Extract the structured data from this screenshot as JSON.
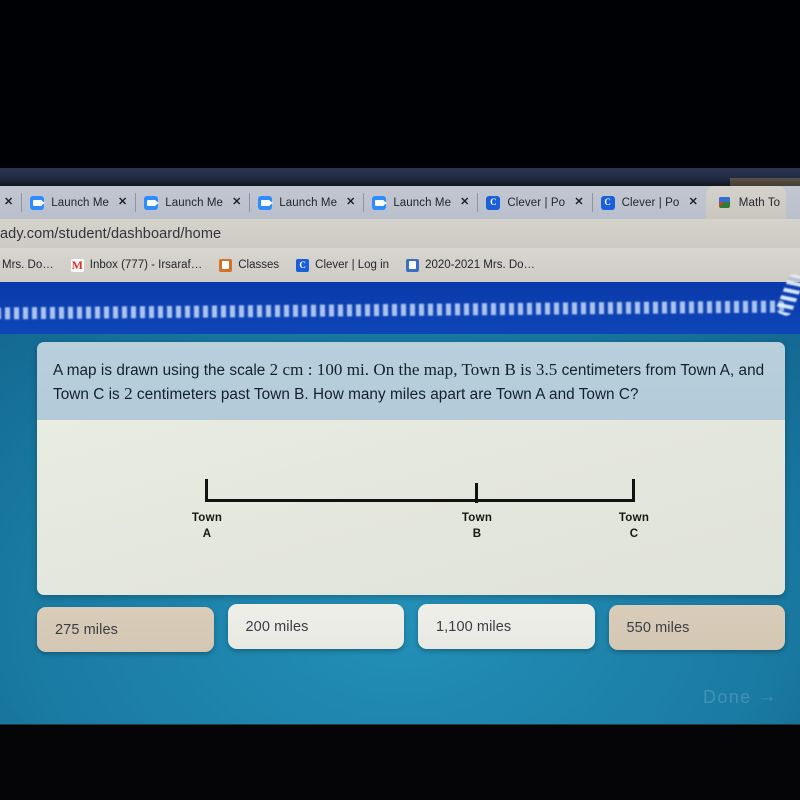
{
  "browser": {
    "tabs": [
      {
        "title": "",
        "favicon": "zoom-icon",
        "active": false,
        "partial": true
      },
      {
        "title": "Launch Me",
        "favicon": "zoom-icon",
        "active": false
      },
      {
        "title": "Launch Me",
        "favicon": "zoom-icon",
        "active": false
      },
      {
        "title": "Launch Me",
        "favicon": "zoom-icon",
        "active": false
      },
      {
        "title": "Launch Me",
        "favicon": "zoom-icon",
        "active": false
      },
      {
        "title": "Clever | Por",
        "favicon": "clever-icon",
        "active": false
      },
      {
        "title": "Clever | Por",
        "favicon": "clever-icon",
        "active": false
      },
      {
        "title": "Math To",
        "favicon": "cube-icon",
        "active": true
      }
    ],
    "tab_close_label": "✕",
    "address": "ady.com/student/dashboard/home",
    "bookmarks": [
      {
        "label": "Mrs. Do…",
        "icon": "none"
      },
      {
        "label": "Inbox (777) - Irsaraf…",
        "icon": "gmail-icon",
        "icon_glyph": "M"
      },
      {
        "label": "Classes",
        "icon": "classroom-icon"
      },
      {
        "label": "Clever | Log in",
        "icon": "clever-icon",
        "icon_glyph": "C"
      },
      {
        "label": "2020-2021 Mrs. Do…",
        "icon": "person-icon"
      }
    ]
  },
  "question": {
    "line1_a": "A map is drawn using the scale ",
    "m1": "2",
    "line1_b": " cm : ",
    "m2": "100",
    "line1_c": " mi. On the map, Town B is ",
    "m3": "3.5",
    "line1_d": " centimeters from Town A, and Town C is ",
    "m4": "2",
    "line1_e": " centimeters past Town B. How many miles apart are Town A and Town C?"
  },
  "diagram": {
    "points": [
      {
        "name": "Town",
        "letter": "A",
        "position_cm": 0
      },
      {
        "name": "Town",
        "letter": "B",
        "position_cm": 3.5
      },
      {
        "name": "Town",
        "letter": "C",
        "position_cm": 5.5
      }
    ]
  },
  "answers": [
    {
      "label": "275 miles",
      "shade": "dark"
    },
    {
      "label": "200 miles",
      "shade": "light"
    },
    {
      "label": "1,100 miles",
      "shade": "light"
    },
    {
      "label": "550 miles",
      "shade": "dark"
    }
  ],
  "footer": {
    "done_label": "Done",
    "done_arrow": "→"
  },
  "colors": {
    "app_background": "#1a7ba3",
    "top_banner": "#0c3fb0",
    "question_header": "#b6cdda",
    "diagram_panel": "#e5e8de",
    "answer_dark": "#d6caB7",
    "answer_light": "#ebece5",
    "line_color": "#10120f"
  }
}
